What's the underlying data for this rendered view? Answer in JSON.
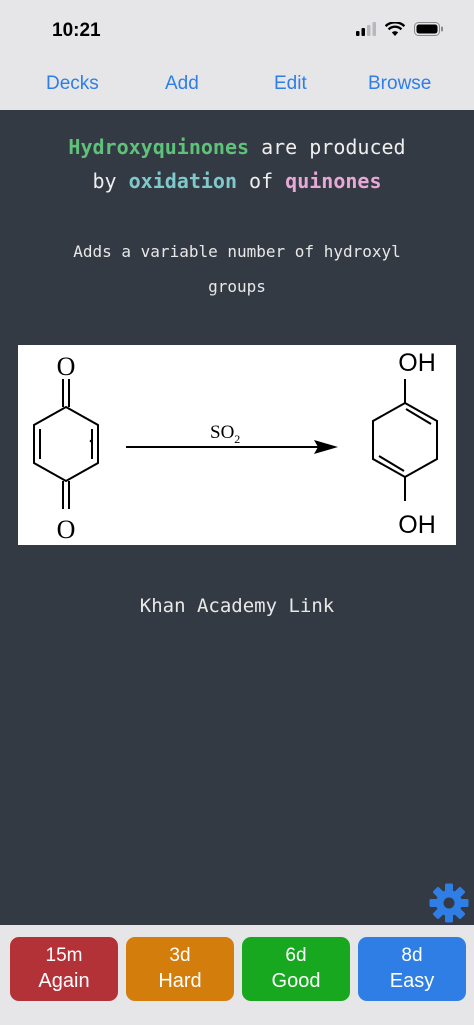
{
  "status_bar": {
    "time": "10:21"
  },
  "nav": {
    "decks": "Decks",
    "add": "Add",
    "edit": "Edit",
    "browse": "Browse"
  },
  "card": {
    "q_part1": "Hydroxyquinones",
    "q_part2": " are produced",
    "q_part3": "by ",
    "q_part4": "oxidation",
    "q_part5": " of ",
    "q_part6": "quinones",
    "note": "Adds a variable number of hydroxyl groups",
    "reagent": "SO",
    "reagent_sub": "2",
    "top_oh": "OH",
    "bottom_oh": "OH",
    "top_o": "O",
    "bottom_o": "O",
    "link": "Khan Academy Link"
  },
  "answers": [
    {
      "time": "15m",
      "label": "Again",
      "color": "#b33238"
    },
    {
      "time": "3d",
      "label": "Hard",
      "color": "#d37d0d"
    },
    {
      "time": "6d",
      "label": "Good",
      "color": "#18a81f"
    },
    {
      "time": "8d",
      "label": "Easy",
      "color": "#2f7ee6"
    }
  ],
  "colors": {
    "accent": "#2f7ee6",
    "card_bg": "#343a44",
    "bar_bg": "#e6e6e9"
  },
  "icons": [
    "signal-icon",
    "wifi-icon",
    "battery-icon",
    "gear-icon"
  ]
}
